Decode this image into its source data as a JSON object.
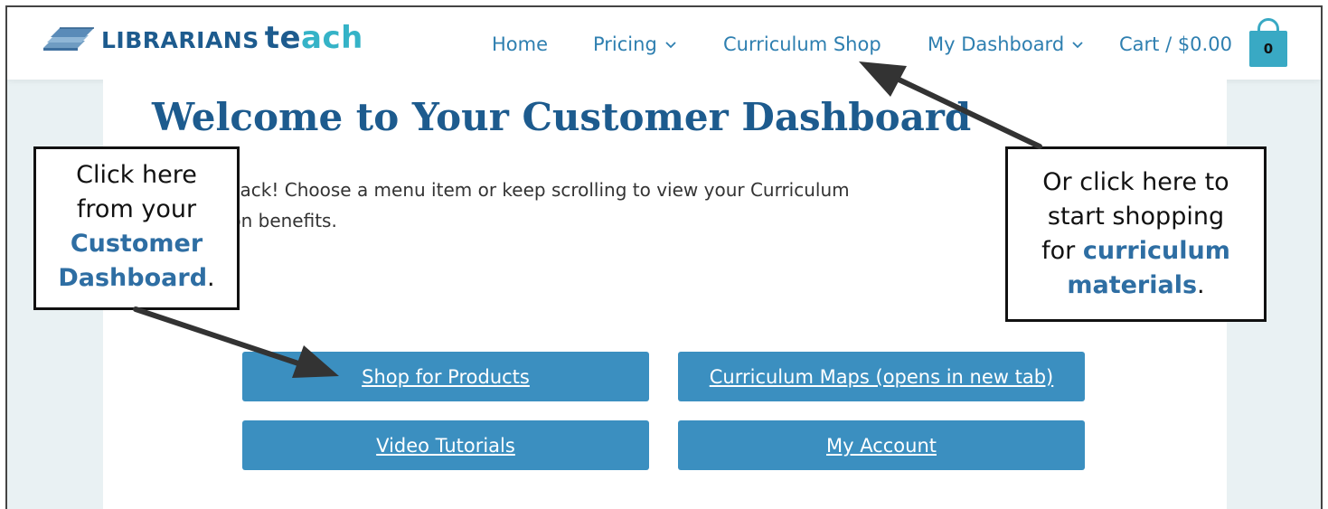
{
  "header": {
    "logo_word1": "LIBRARIANS",
    "logo_word2a": "te",
    "logo_word2b": "ach",
    "nav": {
      "home": "Home",
      "pricing": "Pricing",
      "curriculum_shop": "Curriculum Shop",
      "my_dashboard": "My Dashboard",
      "cart": "Cart / $0.00",
      "cart_count": "0"
    }
  },
  "main": {
    "title": "Welcome to Your Customer Dashboard",
    "intro_line1": "Welcome back! Choose a menu item or keep scrolling to view your Curriculum",
    "intro_line2": "Subscription benefits.",
    "buttons": {
      "shop": "Shop for Products",
      "maps": "Curriculum Maps (opens in new tab)",
      "videos": "Video Tutorials",
      "account": "My Account"
    }
  },
  "callouts": {
    "left": {
      "line1": "Click here",
      "line2": "from your",
      "highlight1": "Customer",
      "highlight2": "Dashboard",
      "suffix": "."
    },
    "right": {
      "line1": "Or click here to",
      "line2": "start shopping",
      "line3_prefix": "for",
      "highlight1": "curriculum",
      "highlight2": "materials",
      "suffix": "."
    }
  },
  "colors": {
    "brand_blue": "#1d5b8e",
    "brand_teal": "#35b3c7",
    "button_blue": "#3b8fc0",
    "nav_blue": "#2e7fb0",
    "page_bg": "#e9f1f3"
  }
}
